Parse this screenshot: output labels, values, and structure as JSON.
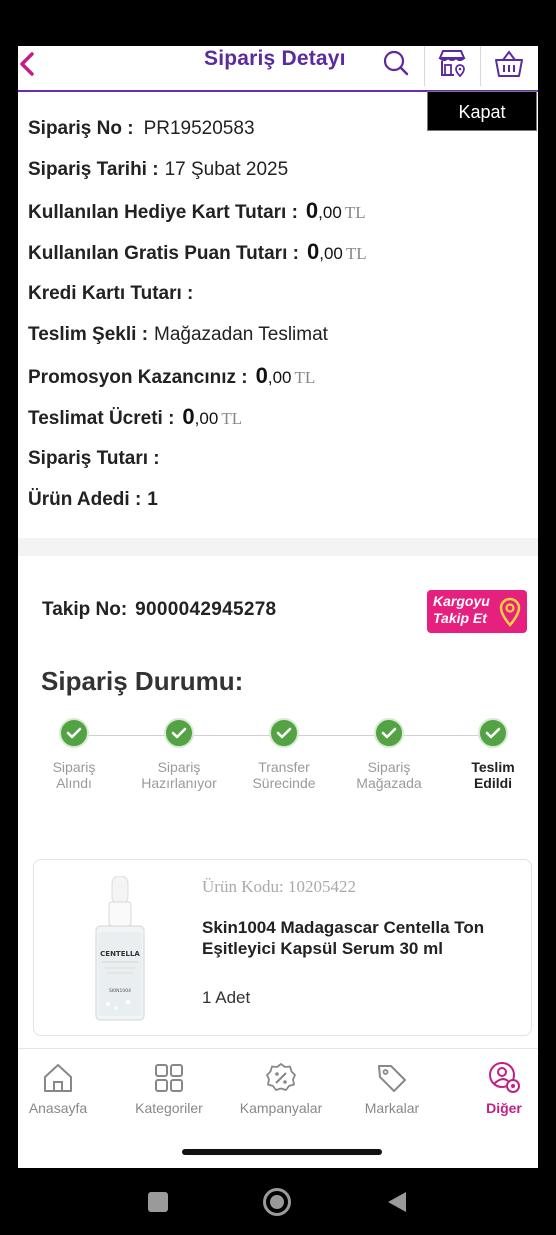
{
  "header": {
    "title": "Sipariş Detayı",
    "back_icon": "chevron-left-icon",
    "icons": [
      "search-icon",
      "store-location-icon",
      "basket-icon"
    ],
    "close_label": "Kapat"
  },
  "order": {
    "no_label": "Sipariş No :",
    "no_value": "PR19520583",
    "date_label": "Sipariş Tarihi :",
    "date_value": "17 Şubat 2025",
    "gift_card_label": "Kullanılan Hediye Kart Tutarı :",
    "gift_card_int": "0",
    "gift_card_dec": ",00",
    "points_label": "Kullanılan Gratis Puan Tutarı :",
    "points_int": "0",
    "points_dec": ",00",
    "credit_card_label": "Kredi Kartı Tutarı :",
    "delivery_type_label": "Teslim Şekli :",
    "delivery_type_value": "Mağazadan Teslimat",
    "promo_label": "Promosyon Kazancınız :",
    "promo_int": "0",
    "promo_dec": ",00",
    "shipping_label": "Teslimat Ücreti :",
    "shipping_int": "0",
    "shipping_dec": ",00",
    "total_label": "Sipariş Tutarı :",
    "count_label": "Ürün Adedi :",
    "count_value": "1",
    "currency": "TL"
  },
  "tracking": {
    "label": "Takip No:",
    "value": "9000042945278",
    "button_line1": "Kargoyu",
    "button_line2": "Takip Et",
    "button_icon": "location-pin-icon"
  },
  "status": {
    "title": "Sipariş Durumu:",
    "steps": [
      {
        "line1": "Sipariş",
        "line2": "Alındı"
      },
      {
        "line1": "Sipariş",
        "line2": "Hazırlanıyor"
      },
      {
        "line1": "Transfer",
        "line2": "Sürecinde"
      },
      {
        "line1": "Sipariş",
        "line2": "Mağazada"
      },
      {
        "line1": "Teslim",
        "line2": "Edildi"
      }
    ],
    "colors": {
      "done": "#53a243",
      "accent": "#6b2bb5",
      "pink": "#e6207f"
    }
  },
  "product": {
    "code": "Ürün Kodu: 10205422",
    "name": "Skin1004 Madagascar Centella Ton Eşitleyici Kapsül Serum 30 ml",
    "qty": "1 Adet",
    "bottle_brand": "CENTELLA",
    "bottle_maker": "SKIN1004"
  },
  "nav": {
    "items": [
      {
        "label": "Anasayfa",
        "icon": "home-icon"
      },
      {
        "label": "Kategoriler",
        "icon": "grid-icon"
      },
      {
        "label": "Kampanyalar",
        "icon": "discount-badge-icon"
      },
      {
        "label": "Markalar",
        "icon": "tag-icon"
      },
      {
        "label": "Diğer",
        "icon": "user-settings-icon"
      }
    ]
  },
  "system_nav": [
    "recents-icon",
    "home-circle-icon",
    "back-triangle-icon"
  ]
}
